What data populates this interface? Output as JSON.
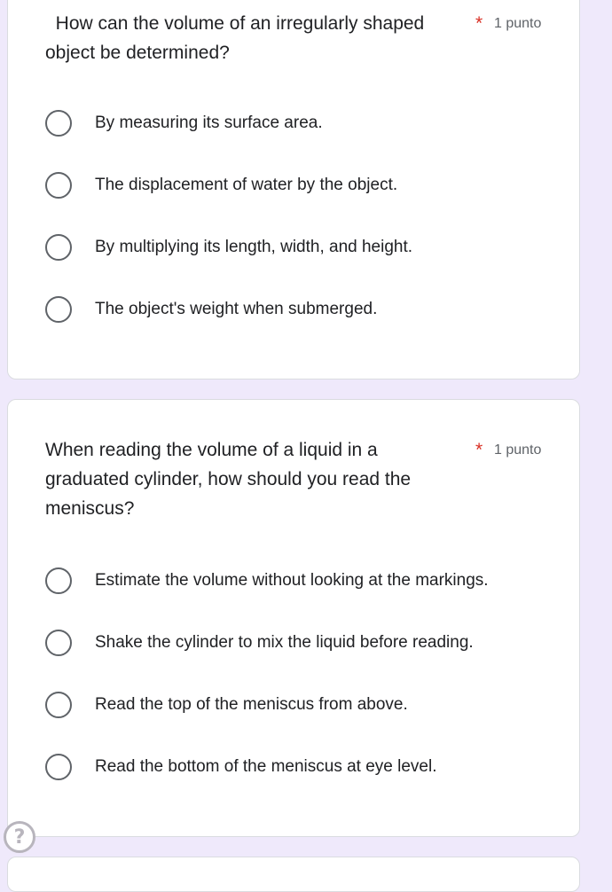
{
  "questions": [
    {
      "title": "  How can the volume of an irregularly shaped object be determined?",
      "required_mark": "*",
      "points": "1 punto",
      "options": [
        "By measuring its surface area.",
        "The displacement of water by the object.",
        "By multiplying its length, width, and height.",
        "The object's weight when submerged."
      ]
    },
    {
      "title": "When reading the volume of a liquid in a graduated cylinder, how should you read the meniscus?",
      "required_mark": "*",
      "points": "1 punto",
      "options": [
        "Estimate the volume without looking at the markings.",
        "Shake the cylinder to mix the liquid before reading.",
        "Read the top of the meniscus from above.",
        "Read the bottom of the meniscus at eye level."
      ]
    }
  ],
  "help": {
    "icon": "help-icon",
    "glyph": "?"
  },
  "colors": {
    "background": "#efe9fb",
    "required": "#d93025",
    "radio_border": "#5f6368"
  }
}
